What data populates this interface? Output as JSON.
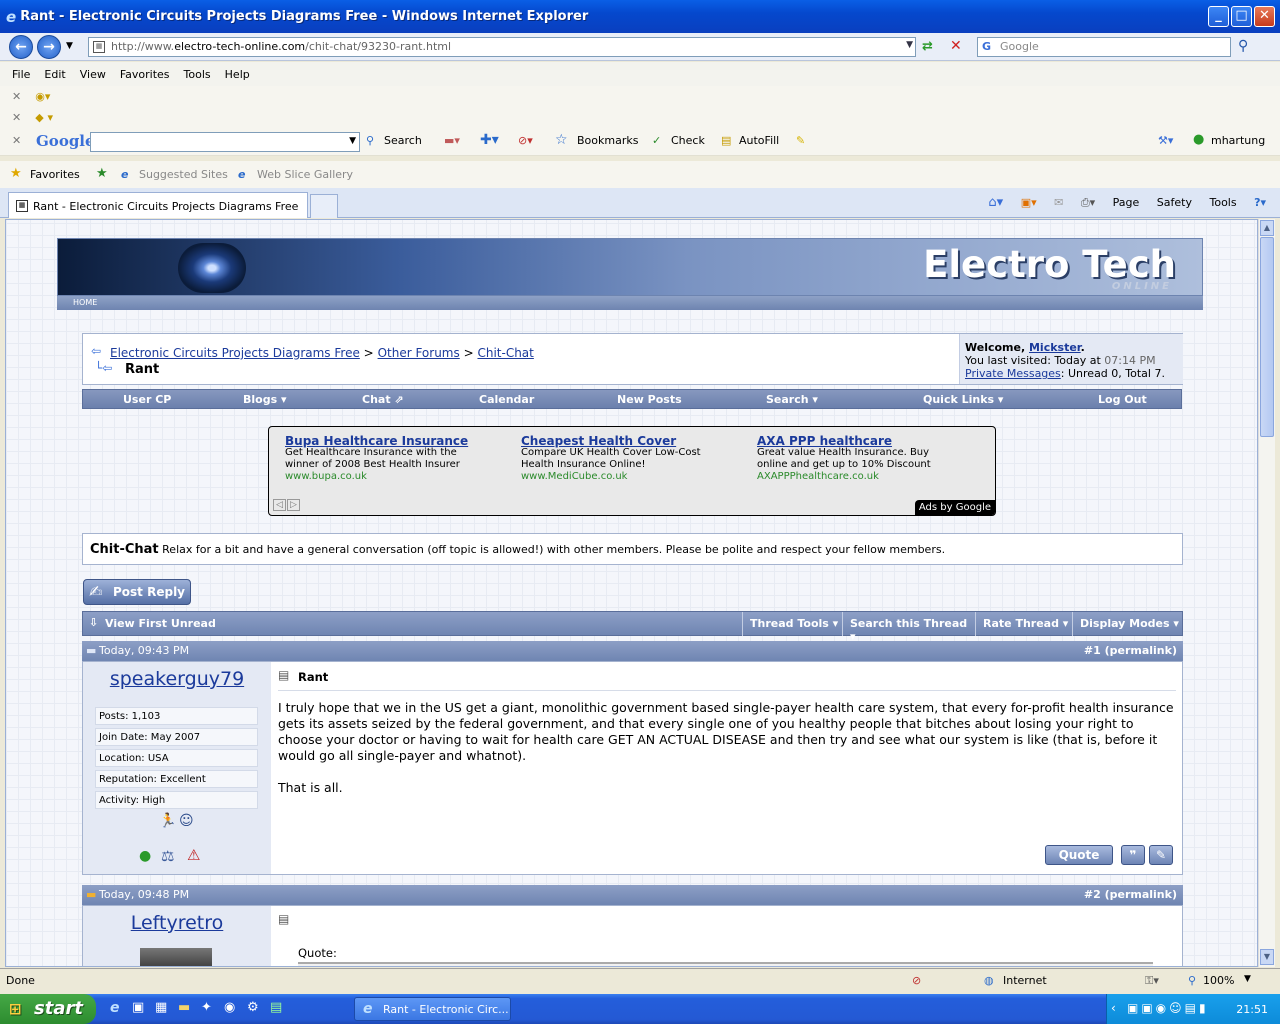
{
  "window": {
    "title": "Rant - Electronic Circuits Projects Diagrams Free - Windows Internet Explorer"
  },
  "address": {
    "prefix": "http://www.",
    "domain": "electro-tech-online.com",
    "path": "/chit-chat/93230-rant.html",
    "search_placeholder": "Google"
  },
  "menu": [
    "File",
    "Edit",
    "View",
    "Favorites",
    "Tools",
    "Help"
  ],
  "google_toolbar": {
    "brand": "Google",
    "search": "Search",
    "bookmarks": "Bookmarks",
    "check": "Check",
    "autofill": "AutoFill",
    "user": "mhartung"
  },
  "favorites": {
    "label": "Favorites",
    "suggested": "Suggested Sites",
    "webslice": "Web Slice Gallery"
  },
  "tab": {
    "title": "Rant - Electronic Circuits Projects Diagrams Free"
  },
  "commands": {
    "page": "Page",
    "safety": "Safety",
    "tools": "Tools"
  },
  "site": {
    "logo": "Electro Tech",
    "logo_sub": "ONLINE",
    "home": "HOME"
  },
  "breadcrumb": {
    "root": "Electronic Circuits Projects Diagrams Free",
    "sep1": ">",
    "forum1": "Other Forums",
    "sep2": ">",
    "forum2": "Chit-Chat",
    "current": "Rant"
  },
  "welcome": {
    "prefix": "Welcome, ",
    "user": "Mickster",
    "suffix": ".",
    "last": "You last visited: Today at ",
    "time": "07:14 PM",
    "pm": "Private Messages",
    "pm_status": ": Unread 0, Total 7."
  },
  "navbar": [
    "User CP",
    "Blogs ▾",
    "Chat ⇗",
    "Calendar",
    "New Posts",
    "Search ▾",
    "Quick Links ▾",
    "Log Out"
  ],
  "ads": [
    {
      "title": "Bupa Healthcare Insurance",
      "line1": "Get Healthcare Insurance with the",
      "line2": "winner of 2008 Best Health Insurer",
      "url": "www.bupa.co.uk"
    },
    {
      "title": "Cheapest Health Cover",
      "line1": "Compare UK Health Cover Low-Cost",
      "line2": "Health Insurance Online!",
      "url": "www.MediCube.co.uk"
    },
    {
      "title": "AXA PPP healthcare",
      "line1": "Great value Health Insurance. Buy",
      "line2": "online and get up to 10% Discount",
      "url": "AXAPPPhealthcare.co.uk"
    }
  ],
  "ads_by": "Ads by Google",
  "forum": {
    "name": "Chit-Chat",
    "desc": "Relax for a bit and have a general conversation (off topic is allowed!) with other members. Please be polite and respect your fellow members."
  },
  "buttons": {
    "post_reply": "Post Reply",
    "quote": "Quote"
  },
  "threadbar": {
    "first_unread": "View First Unread",
    "tools": "Thread Tools ▾",
    "search": "Search this Thread ▾",
    "rate": "Rate Thread ▾",
    "modes": "Display Modes ▾"
  },
  "post1": {
    "date": "Today, 09:43 PM",
    "num": "#1",
    "permalink": "permalink",
    "user": "speakerguy79",
    "stats": [
      "Posts: 1,103",
      "Join Date: May 2007",
      "Location: USA",
      "Reputation: Excellent",
      "Activity: High"
    ],
    "title": "Rant",
    "body": "I truly hope that we in the US get a giant, monolithic government based single-payer health care system, that every for-profit health insurance gets its assets seized by the federal government, and that every single one of you healthy people that bitches about losing your right to choose your doctor or having to wait for health care GET AN ACTUAL DISEASE and then try and see what our system is like (that is, before it would go all single-payer and whatnot).",
    "body2": "That is all."
  },
  "post2": {
    "date": "Today, 09:48 PM",
    "num": "#2",
    "permalink": "permalink",
    "user": "Leftyretro",
    "quote_label": "Quote:"
  },
  "status": {
    "text": "Done",
    "zone": "Internet",
    "zoom": "100%"
  },
  "taskbar": {
    "start": "start",
    "task": "Rant - Electronic Circ...",
    "clock": "21:51"
  }
}
